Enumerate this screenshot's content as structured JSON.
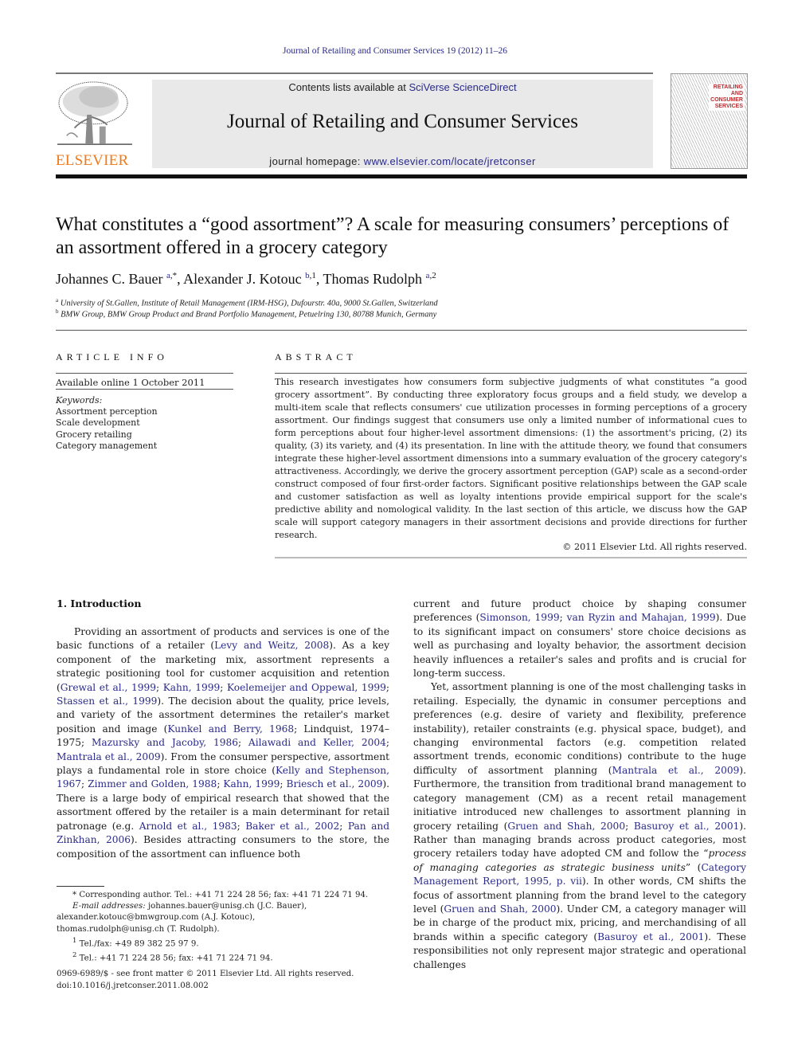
{
  "running_head": "Journal of Retailing and Consumer Services 19 (2012) 11–26",
  "masthead": {
    "publisher_logo": "tree-logo",
    "publisher_name": "ELSEVIER",
    "contents_prefix": "Contents lists available at ",
    "contents_link": "SciVerse ScienceDirect",
    "journal_title": "Journal of Retailing and Consumer Services",
    "homepage_prefix": "journal homepage: ",
    "homepage_link": "www.elsevier.com/locate/jretconser",
    "cover_lines": [
      "RETAILING",
      "AND",
      "CONSUMER",
      "SERVICES"
    ]
  },
  "colors": {
    "link": "#2a2a8a",
    "elsevier_orange": "#f07a1a",
    "cover_red": "#c0282d",
    "masthead_bg": "#e9e9e9"
  },
  "article": {
    "title": "What constitutes a “good assortment”? A scale for measuring consumers’ perceptions of an assortment offered in a grocery category",
    "authors": [
      {
        "name": "Johannes C. Bauer",
        "aff": "a",
        "mark": ",*"
      },
      {
        "name": "Alexander J. Kotouc",
        "aff": "b",
        "mark": ",1"
      },
      {
        "name": "Thomas Rudolph",
        "aff": "a",
        "mark": ",2"
      }
    ],
    "affiliations": [
      {
        "key": "a",
        "text": "University of St.Gallen, Institute of Retail Management (IRM-HSG), Dufourstr. 40a, 9000 St.Gallen, Switzerland"
      },
      {
        "key": "b",
        "text": "BMW Group, BMW Group Product and Brand Portfolio Management, Petuelring 130, 80788 Munich, Germany"
      }
    ]
  },
  "article_info": {
    "heading": "ARTICLE INFO",
    "available_online": "Available online 1 October 2011",
    "keywords_label": "Keywords:",
    "keywords": [
      "Assortment perception",
      "Scale development",
      "Grocery retailing",
      "Category management"
    ]
  },
  "abstract": {
    "heading": "ABSTRACT",
    "text": "This research investigates how consumers form subjective judgments of what constitutes “a good grocery assortment”. By conducting three exploratory focus groups and a field study, we develop a multi-item scale that reflects consumers' cue utilization processes in forming perceptions of a grocery assortment. Our findings suggest that consumers use only a limited number of informational cues to form perceptions about four higher-level assortment dimensions: (1) the assortment's pricing, (2) its quality, (3) its variety, and (4) its presentation. In line with the attitude theory, we found that consumers integrate these higher-level assortment dimensions into a summary evaluation of the grocery category's attractiveness. Accordingly, we derive the grocery assortment perception (GAP) scale as a second-order construct composed of four first-order factors. Significant positive relationships between the GAP scale and customer satisfaction as well as loyalty intentions provide empirical support for the scale's predictive ability and nomological validity. In the last section of this article, we discuss how the GAP scale will support category managers in their assortment decisions and provide directions for further research.",
    "copyright": "© 2011 Elsevier Ltd. All rights reserved."
  },
  "body": {
    "section_heading": "1.   Introduction",
    "left_paragraph": [
      {
        "t": "Providing an assortment of products and services is one of the basic functions of a retailer ("
      },
      {
        "l": "Levy and Weitz, 2008"
      },
      {
        "t": "). As a key component of the marketing mix, assortment represents a strategic positioning tool for customer acquisition and retention ("
      },
      {
        "l": "Grewal et al., 1999"
      },
      {
        "t": "; "
      },
      {
        "l": "Kahn, 1999"
      },
      {
        "t": "; "
      },
      {
        "l": "Koelemeijer and Oppewal, 1999"
      },
      {
        "t": "; "
      },
      {
        "l": "Stassen et al., 1999"
      },
      {
        "t": "). The decision about the quality, price levels, and variety of the assortment determines the retailer's market position and image ("
      },
      {
        "l": "Kunkel and Berry, 1968"
      },
      {
        "t": "; Lindquist, 1974–1975; "
      },
      {
        "l": "Mazursky and Jacoby, 1986"
      },
      {
        "t": "; "
      },
      {
        "l": "Ailawadi and Keller, 2004"
      },
      {
        "t": "; "
      },
      {
        "l": "Mantrala et al., 2009"
      },
      {
        "t": "). From the consumer perspective, assortment plays a fundamental role in store choice ("
      },
      {
        "l": "Kelly and Stephenson, 1967"
      },
      {
        "t": "; "
      },
      {
        "l": "Zimmer and Golden, 1988"
      },
      {
        "t": "; "
      },
      {
        "l": "Kahn, 1999"
      },
      {
        "t": "; "
      },
      {
        "l": "Briesch et al., 2009"
      },
      {
        "t": "). There is a large body of empirical research that showed that the assortment offered by the retailer is a main determinant for retail patronage (e.g. "
      },
      {
        "l": "Arnold et al., 1983"
      },
      {
        "t": "; "
      },
      {
        "l": "Baker et al., 2002"
      },
      {
        "t": "; "
      },
      {
        "l": "Pan and Zinkhan, 2006"
      },
      {
        "t": "). Besides attracting consumers to the store, the composition of the assortment can influence both"
      }
    ],
    "right_paragraph_1": [
      {
        "t": "current and future product choice by shaping consumer preferences ("
      },
      {
        "l": "Simonson, 1999"
      },
      {
        "t": "; "
      },
      {
        "l": "van Ryzin and Mahajan, 1999"
      },
      {
        "t": "). Due to its significant impact on consumers' store choice decisions as well as purchasing and loyalty behavior, the assortment decision heavily influences a retailer's sales and profits and is crucial for long-term success."
      }
    ],
    "right_paragraph_2": [
      {
        "t": "Yet, assortment planning is one of the most challenging tasks in retailing. Especially, the dynamic in consumer perceptions and preferences (e.g. desire of variety and flexibility, preference instability), retailer constraints (e.g. physical space, budget), and changing environmental factors (e.g. competition related assortment trends, economic conditions) contribute to the huge difficulty of assortment planning ("
      },
      {
        "l": "Mantrala et al., 2009"
      },
      {
        "t": "). Furthermore, the transition from traditional brand management to category management (CM) as a recent retail management initiative introduced new challenges to assortment planning in grocery retailing ("
      },
      {
        "l": "Gruen and Shah, 2000"
      },
      {
        "t": "; "
      },
      {
        "l": "Basuroy et al., 2001"
      },
      {
        "t": "). Rather than managing brands across product categories, most grocery retailers today have adopted CM and follow the “"
      },
      {
        "i": "process of managing categories as strategic business units"
      },
      {
        "t": "” ("
      },
      {
        "l": "Category Management Report, 1995, p. vii"
      },
      {
        "t": "). In other words, CM shifts the focus of assortment planning from the brand level to the category level ("
      },
      {
        "l": "Gruen and Shah, 2000"
      },
      {
        "t": "). Under CM, a category manager will be in charge of the product mix, pricing, and merchandising of all brands within a specific category ("
      },
      {
        "l": "Basuroy et al., 2001"
      },
      {
        "t": "). These responsibilities not only represent major strategic and operational challenges"
      }
    ]
  },
  "footnotes": {
    "corresponding": "* Corresponding author. Tel.: +41 71 224 28 56; fax: +41 71 224 71 94.",
    "email_label": "E-mail addresses:",
    "email_1": " johannes.bauer@unisg.ch (J.C. Bauer),",
    "email_2": "alexander.kotouc@bmwgroup.com (A.J. Kotouc),",
    "email_3": "thomas.rudolph@unisg.ch (T. Rudolph).",
    "fn1_mark": "1",
    "fn1": " Tel./fax: +49 89 382 25 97 9.",
    "fn2_mark": "2",
    "fn2": " Tel.: +41 71 224 28 56; fax: +41 71 224 71 94."
  },
  "front_matter": {
    "issn": "0969-6989/$ - see front matter © 2011 Elsevier Ltd. All rights reserved.",
    "doi": "doi:10.1016/j.jretconser.2011.08.002"
  }
}
